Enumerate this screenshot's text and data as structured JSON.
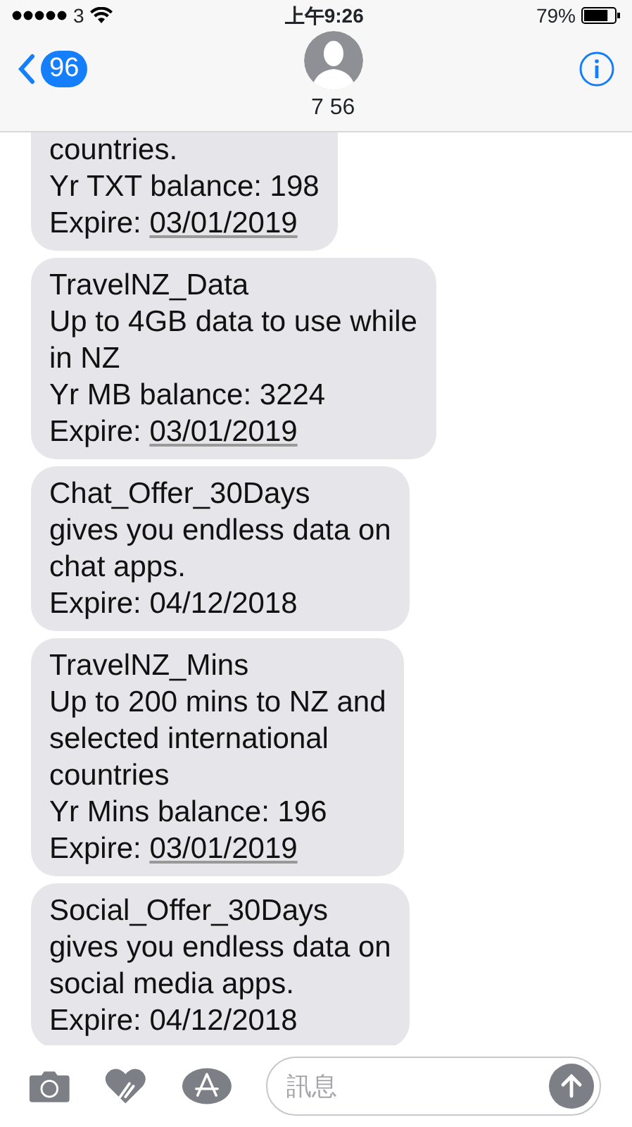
{
  "status_bar": {
    "carrier": "3",
    "time": "上午9:26",
    "battery": "79%"
  },
  "header": {
    "back_count": "96",
    "contact": "7 56"
  },
  "messages": [
    {
      "cut_top": true,
      "lines": [
        {
          "text": "countries."
        },
        {
          "text": "Yr TXT balance: 198"
        },
        {
          "text": "Expire: ",
          "link": "03/01/2019"
        }
      ]
    },
    {
      "cut_top": false,
      "lines": [
        {
          "text": "TravelNZ_Data"
        },
        {
          "text": "Up to 4GB data to use while"
        },
        {
          "text": "in NZ"
        },
        {
          "text": "Yr MB balance: 3224"
        },
        {
          "text": "Expire: ",
          "link": "03/01/2019"
        }
      ]
    },
    {
      "cut_top": false,
      "lines": [
        {
          "text": "Chat_Offer_30Days"
        },
        {
          "text": "gives you endless data on"
        },
        {
          "text": "chat apps."
        },
        {
          "text": "Expire: 04/12/2018"
        }
      ]
    },
    {
      "cut_top": false,
      "lines": [
        {
          "text": "TravelNZ_Mins"
        },
        {
          "text": "Up to 200 mins to NZ and"
        },
        {
          "text": "selected international"
        },
        {
          "text": "countries"
        },
        {
          "text": "Yr Mins balance: 196"
        },
        {
          "text": "Expire: ",
          "link": "03/01/2019"
        }
      ]
    },
    {
      "cut_top": false,
      "lines": [
        {
          "text": "Social_Offer_30Days"
        },
        {
          "text": "gives you endless data on"
        },
        {
          "text": "social media apps."
        },
        {
          "text": "Expire: 04/12/2018"
        }
      ]
    }
  ],
  "composer": {
    "placeholder": "訊息"
  }
}
